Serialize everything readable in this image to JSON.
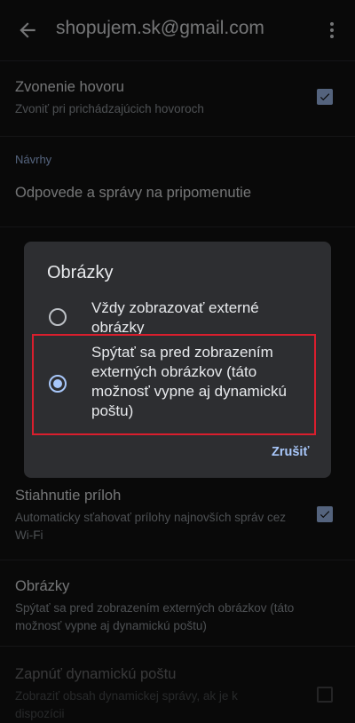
{
  "header": {
    "account": "shopujem.sk@gmail.com",
    "back_icon": "arrow-left-icon",
    "more_icon": "more-vert-icon"
  },
  "settings": {
    "ringtone": {
      "title": "Zvonenie hovoru",
      "subtitle": "Zvoniť pri prichádzajúcich hovoroch",
      "checked": true
    },
    "section_navrhy": "Návrhy",
    "reminders": {
      "title": "Odpovede a správy na pripomenutie"
    },
    "attachments": {
      "title": "Stiahnutie príloh",
      "subtitle": "Automaticky sťahovať prílohy najnovších správ cez Wi‑Fi",
      "checked": true
    },
    "images": {
      "title": "Obrázky",
      "subtitle": "Spýtať sa pred zobrazením externých obrázkov (táto možnosť vypne aj dynamickú poštu)"
    },
    "dynamic_mail": {
      "title": "Zapnúť dynamickú poštu",
      "subtitle": "Zobraziť obsah dynamickej správy, ak je k dispozícii",
      "checked": false
    }
  },
  "dialog": {
    "title": "Obrázky",
    "options": [
      {
        "label": "Vždy zobrazovať externé obrázky",
        "selected": false
      },
      {
        "label": "Spýtať sa pred zobrazením externých obrázkov (táto možnosť vypne aj dynamickú poštu)",
        "selected": true
      }
    ],
    "cancel_label": "Zrušiť"
  },
  "colors": {
    "accent": "#a8c7fa",
    "highlight_border": "#d91e2d",
    "background": "#121212",
    "dialog": "#2d2e31"
  }
}
